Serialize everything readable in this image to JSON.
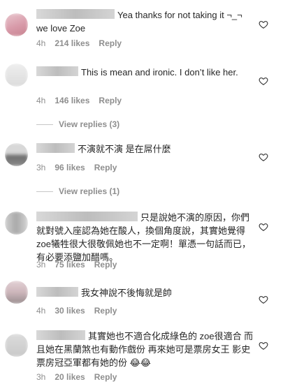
{
  "comments": [
    {
      "text": "Yea thanks for not taking it ¬_¬ we love Zoe",
      "time": "4h",
      "likes": "214 likes",
      "reply": "Reply"
    },
    {
      "text": "This is mean and ironic. I don’t like her.",
      "time": "4h",
      "likes": "146 likes",
      "reply": "Reply"
    },
    {
      "text": "不演就不演 是在屌什麼",
      "time": "3h",
      "likes": "96 likes",
      "reply": "Reply"
    },
    {
      "text": "只是說她不演的原因，你們就對號入座認為她在酸人，換個角度說，其實她覺得zoe犧牲很大很敬佩她也不一定啊！單憑一句話而已，有必要添鹽加醋嗎。",
      "time": "3h",
      "likes": "75 likes",
      "reply": "Reply"
    },
    {
      "text": "我女神說不後悔就是帥",
      "time": "4h",
      "likes": "30 likes",
      "reply": "Reply"
    },
    {
      "text": "其實她也不適合化成綠色的 zoe很適合 而且她在黑蘭煞也有動作戲份 再來她可是票房女王 影史票房冠亞軍都有她的份 😂😂",
      "time": "3h",
      "likes": "20 likes",
      "reply": "Reply"
    }
  ],
  "view_replies": [
    {
      "label": "View replies (3)"
    },
    {
      "label": "View replies (1)"
    }
  ],
  "colors": {
    "text": "#262626",
    "muted": "#8e8e8e",
    "divider": "#c7c7c7"
  },
  "icons": {
    "like": "heart-outline-icon"
  }
}
